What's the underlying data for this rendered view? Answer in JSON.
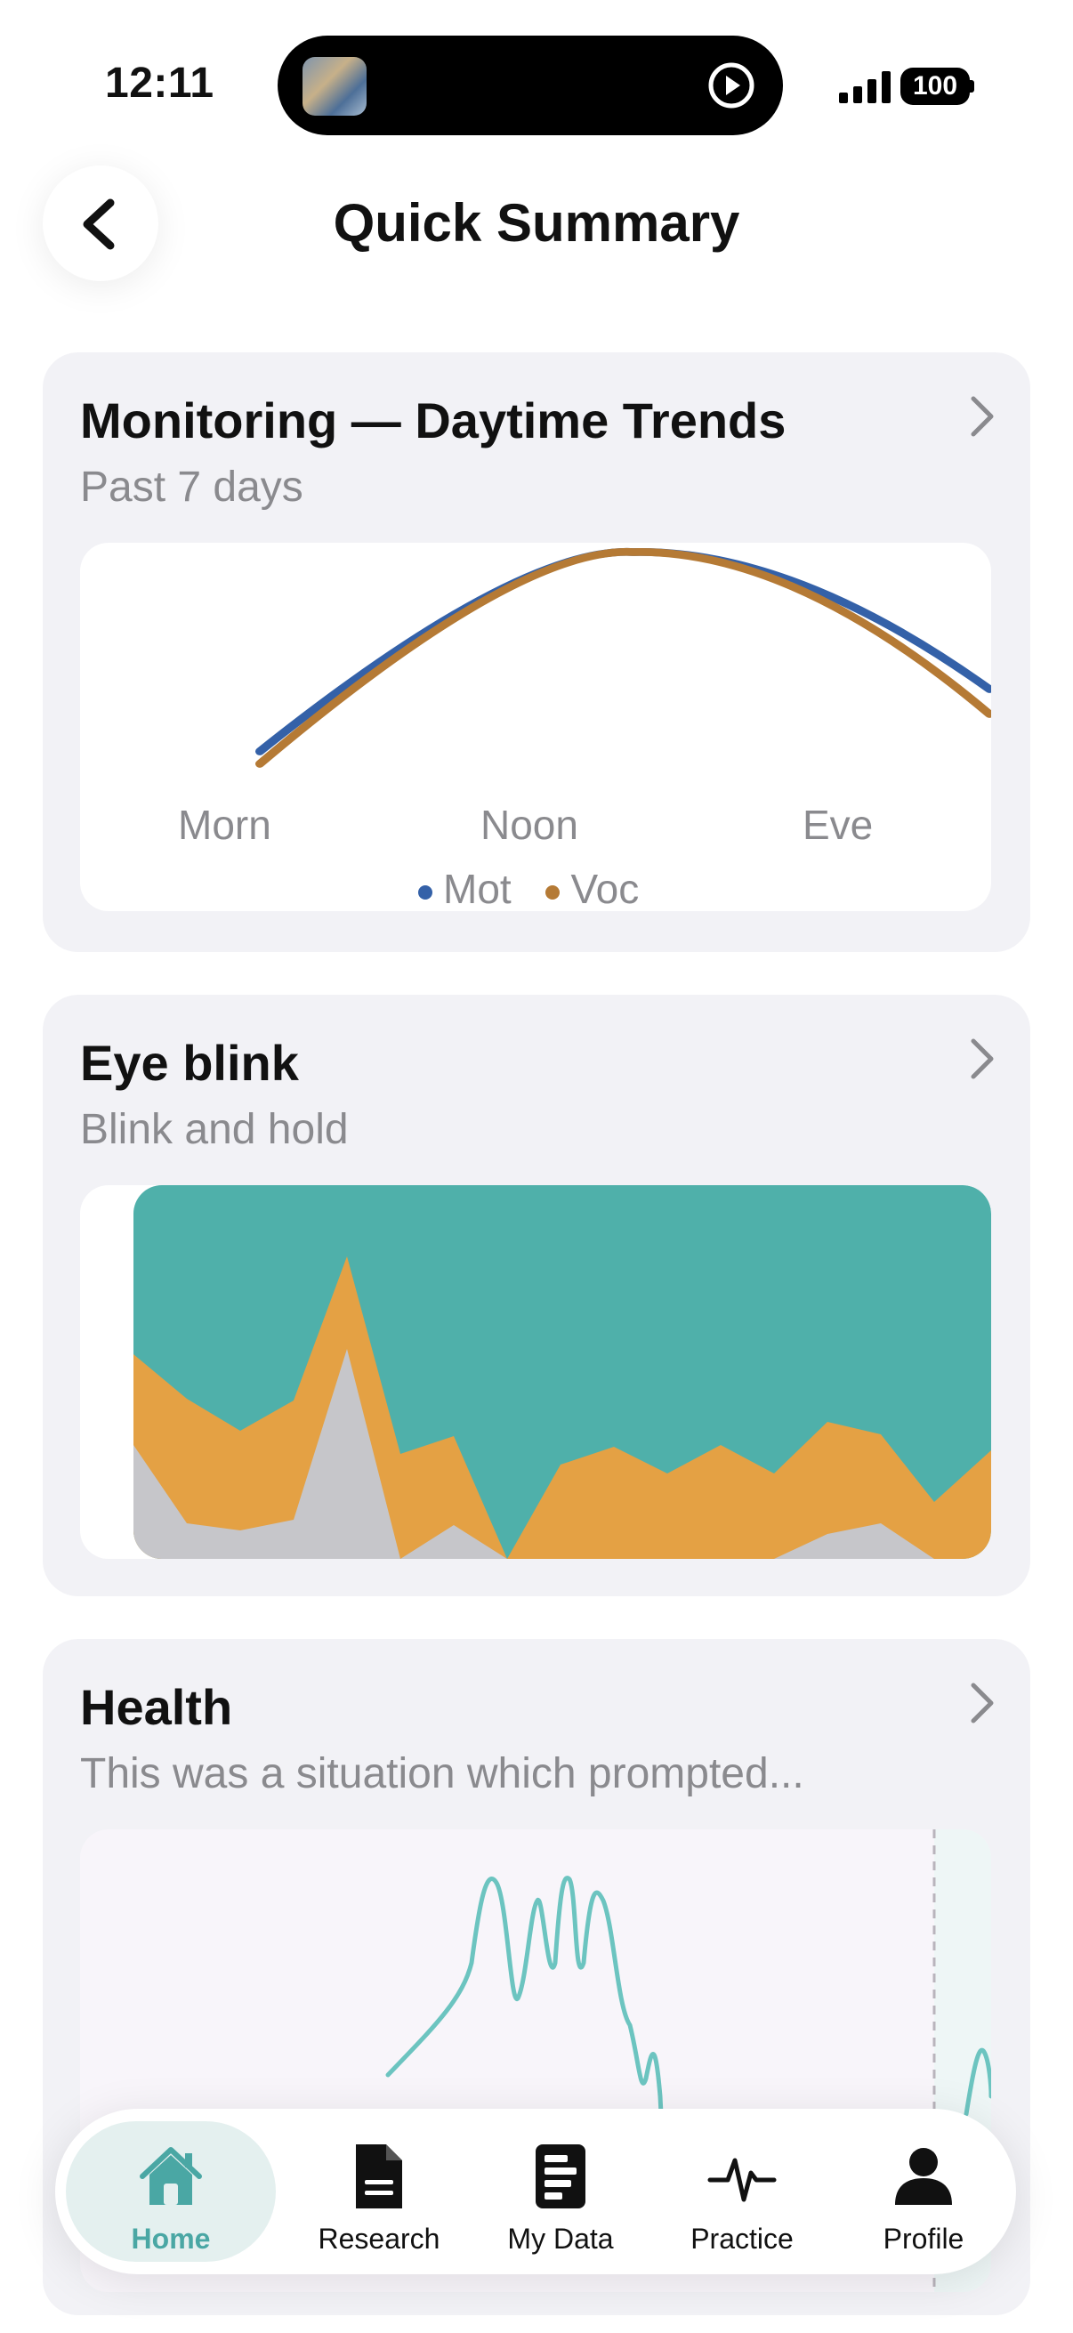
{
  "status": {
    "time": "12:11",
    "battery": "100"
  },
  "header": {
    "title": "Quick Summary"
  },
  "cards": {
    "monitoring": {
      "title": "Monitoring — Daytime Trends",
      "subtitle": "Past 7 days",
      "x_labels": [
        "Morn",
        "Noon",
        "Eve"
      ],
      "legend": [
        {
          "name": "Mot",
          "color": "#3461a8"
        },
        {
          "name": "Voc",
          "color": "#b57a35"
        }
      ]
    },
    "eye_blink": {
      "title": "Eye blink",
      "subtitle": "Blink and hold",
      "colors": {
        "top": "#4fb0aa",
        "middle": "#e4a144",
        "bottom": "#c6c6ca"
      }
    },
    "health": {
      "title": "Health",
      "subtitle": "This was a situation which prompted...",
      "color": "#6cc4c0"
    }
  },
  "chart_data": [
    {
      "type": "line",
      "categories": [
        "Morn",
        "Noon",
        "Eve"
      ],
      "series": [
        {
          "name": "Mot",
          "values": [
            0.2,
            1.0,
            0.45
          ]
        },
        {
          "name": "Voc",
          "values": [
            0.15,
            1.0,
            0.35
          ]
        }
      ]
    }
  ],
  "tabbar": {
    "items": [
      {
        "label": "Home",
        "icon": "home-icon",
        "active": true
      },
      {
        "label": "Research",
        "icon": "document-icon",
        "active": false
      },
      {
        "label": "My Data",
        "icon": "data-icon",
        "active": false
      },
      {
        "label": "Practice",
        "icon": "pulse-icon",
        "active": false
      },
      {
        "label": "Profile",
        "icon": "person-icon",
        "active": false
      }
    ],
    "active_color": "#4aa7a4"
  }
}
